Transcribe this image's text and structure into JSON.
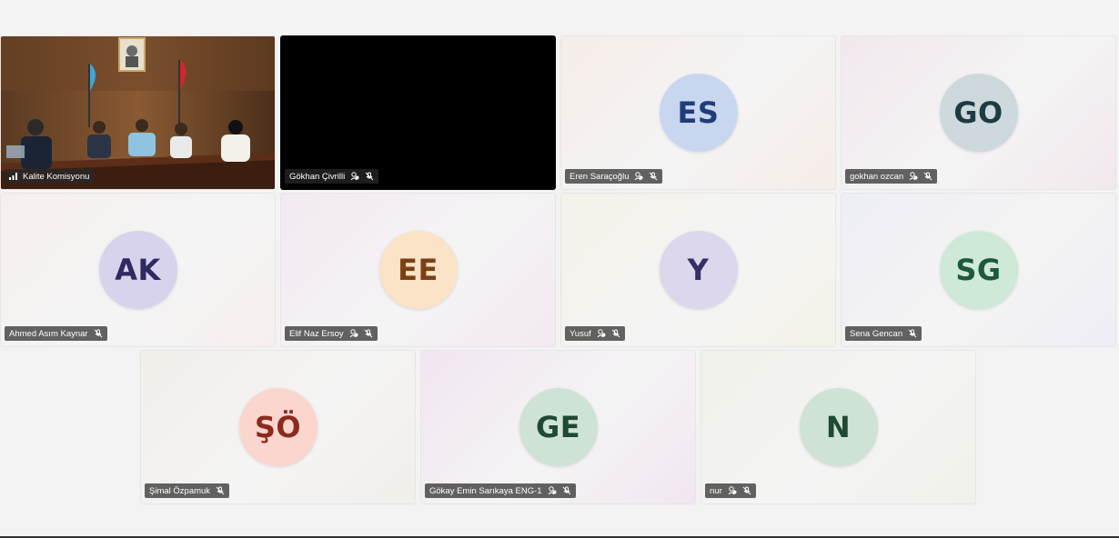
{
  "participants": [
    {
      "name": "Kalite Komisyonu",
      "type": "video",
      "signal": true,
      "pin": false,
      "mic_muted": false
    },
    {
      "name": "Gökhan Çivrilli",
      "type": "black",
      "pin": true,
      "mic_muted": true
    },
    {
      "name": "Eren Saraçoğlu",
      "initials": "ES",
      "avatar_bg": "#c8d7ef",
      "avatar_fg": "#1f3d7a",
      "tile_bg": "#f6ede8",
      "pin": true,
      "mic_muted": true
    },
    {
      "name": "gokhan ozcan",
      "initials": "GO",
      "avatar_bg": "#cdd9dc",
      "avatar_fg": "#1e3a43",
      "tile_bg": "#f2e8ee",
      "pin": true,
      "mic_muted": true
    },
    {
      "name": "Ahmed Asım Kaynar",
      "initials": "AK",
      "avatar_bg": "#d7d3ec",
      "avatar_fg": "#2f2a62",
      "tile_bg": "#f6efee",
      "pin": false,
      "mic_muted": true
    },
    {
      "name": "Elif Naz Ersoy",
      "initials": "EE",
      "avatar_bg": "#fbe3c8",
      "avatar_fg": "#7a4214",
      "tile_bg": "#f3e9f2",
      "pin": true,
      "mic_muted": true
    },
    {
      "name": "Yusuf",
      "initials": "Y",
      "avatar_bg": "#ddd7ee",
      "avatar_fg": "#372e68",
      "tile_bg": "#f5f2e8",
      "pin": true,
      "mic_muted": true
    },
    {
      "name": "Sena Gencan",
      "initials": "SG",
      "avatar_bg": "#cfe9d9",
      "avatar_fg": "#1c5a3a",
      "tile_bg": "#eeeef6",
      "pin": false,
      "mic_muted": true
    },
    {
      "name": "Şimal Özpamuk",
      "initials": "ŞÖ",
      "avatar_bg": "#fbd6cf",
      "avatar_fg": "#8c2a1e",
      "tile_bg": "#f2efea",
      "pin": false,
      "mic_muted": true
    },
    {
      "name": "Gökay Emin Sarıkaya ENG-1",
      "initials": "GE",
      "avatar_bg": "#cfe2d6",
      "avatar_fg": "#1e4a33",
      "tile_bg": "#f2e6f2",
      "pin": true,
      "mic_muted": true
    },
    {
      "name": "nur",
      "initials": "N",
      "avatar_bg": "#cfe2d6",
      "avatar_fg": "#1e4a33",
      "tile_bg": "#f0f2ea",
      "pin": true,
      "mic_muted": true
    }
  ],
  "icons": {
    "pin": "pin-icon",
    "mic_muted": "mic-off-icon",
    "signal": "signal-bars-icon"
  }
}
